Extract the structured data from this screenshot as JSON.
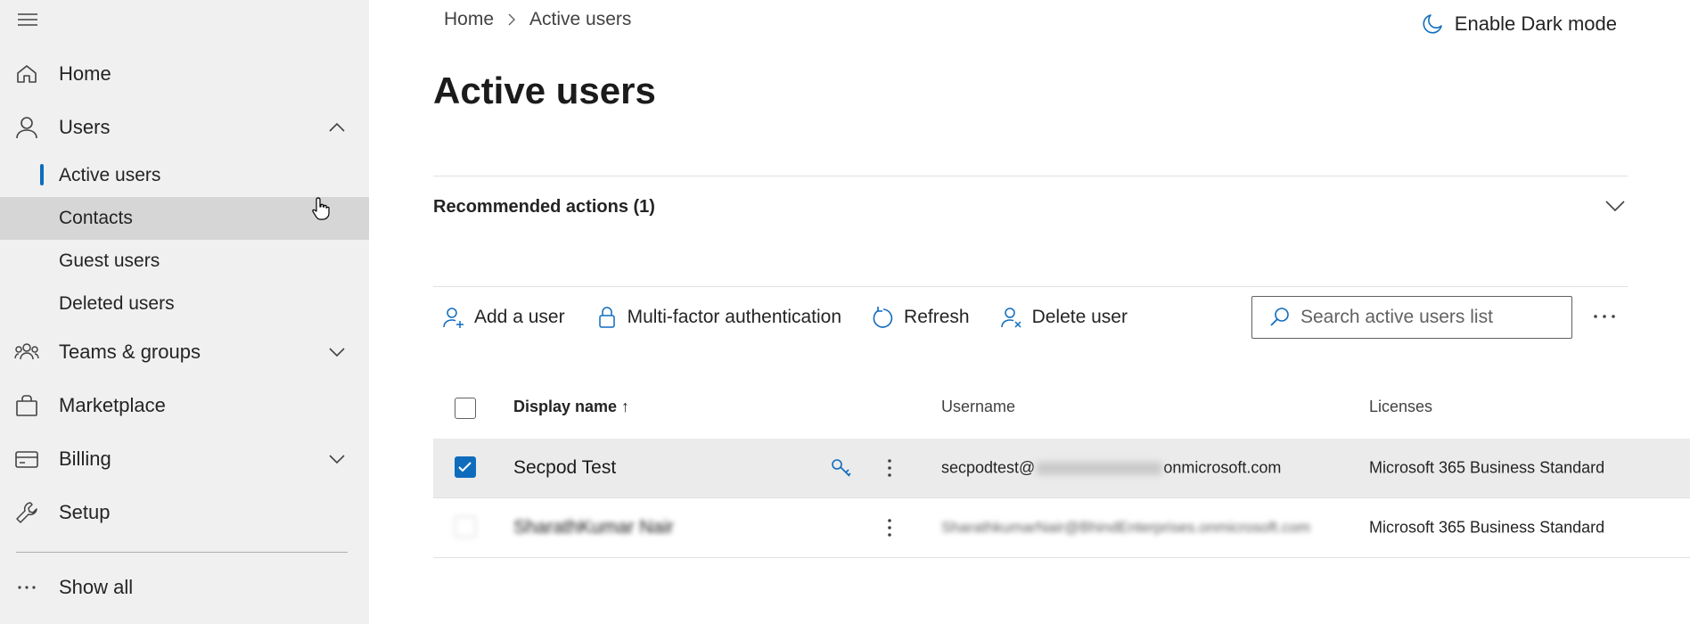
{
  "sidebar": {
    "items": [
      {
        "label": "Home",
        "icon": "home-icon"
      },
      {
        "label": "Users",
        "icon": "user-icon",
        "expanded": true
      },
      {
        "label": "Teams & groups",
        "icon": "teams-icon",
        "expanded": false
      },
      {
        "label": "Marketplace",
        "icon": "shopping-bag-icon"
      },
      {
        "label": "Billing",
        "icon": "credit-card-icon",
        "expanded": false
      },
      {
        "label": "Setup",
        "icon": "wrench-icon"
      }
    ],
    "user_subitems": [
      {
        "label": "Active users",
        "selected": true
      },
      {
        "label": "Contacts",
        "hovered": true
      },
      {
        "label": "Guest users"
      },
      {
        "label": "Deleted users"
      }
    ],
    "show_all": "Show all"
  },
  "breadcrumb": {
    "home": "Home",
    "current": "Active users"
  },
  "dark_mode_label": "Enable Dark mode",
  "page_title": "Active users",
  "recommended": {
    "label": "Recommended actions (1)"
  },
  "toolbar": {
    "add_user": "Add a user",
    "mfa": "Multi-factor authentication",
    "refresh": "Refresh",
    "delete_user": "Delete user"
  },
  "search": {
    "placeholder": "Search active users list"
  },
  "table": {
    "headers": {
      "display_name": "Display name ↑",
      "username": "Username",
      "licenses": "Licenses"
    },
    "rows": [
      {
        "display_name": "Secpod Test",
        "username_prefix": "secpodtest@",
        "username_suffix": "onmicrosoft.com",
        "license": "Microsoft 365 Business Standard",
        "checked": true
      },
      {
        "display_name": "SharathKumar Nair",
        "username": "SharathkumarNair@BhindEnterprises.onmicrosoft.com",
        "license": "Microsoft 365 Business Standard",
        "checked": false
      }
    ]
  },
  "colors": {
    "accent": "#0f6cbd",
    "sidebar_bg": "#f0f0f0",
    "hover_bg": "#d6d6d6",
    "selected_row_bg": "#ebebeb"
  }
}
